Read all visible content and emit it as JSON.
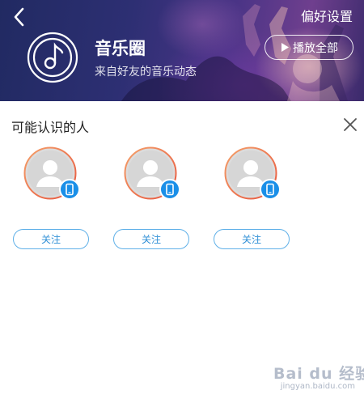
{
  "header": {
    "back_icon": "chevron-left-icon",
    "prefs_label": "偏好设置",
    "title": "音乐圈",
    "subtitle": "来自好友的音乐动态",
    "play_all_label": "播放全部",
    "logo_icon": "music-note-icon"
  },
  "suggestions": {
    "title": "可能认识的人",
    "close_icon": "close-icon",
    "people": [
      {
        "name": "",
        "badge_icon": "phone-icon",
        "follow_label": "关注"
      },
      {
        "name": "",
        "badge_icon": "phone-icon",
        "follow_label": "关注"
      },
      {
        "name": "",
        "badge_icon": "phone-icon",
        "follow_label": "关注"
      }
    ]
  },
  "watermark": {
    "brand": "Bai du 经验",
    "url": "jingyan.baidu.com"
  },
  "colors": {
    "accent_blue": "#2f8fd6",
    "button_border": "#5fb0e8",
    "ring_orange": "#f28c4f",
    "ring_red": "#e8553d",
    "badge_blue": "#1a8fe8"
  }
}
